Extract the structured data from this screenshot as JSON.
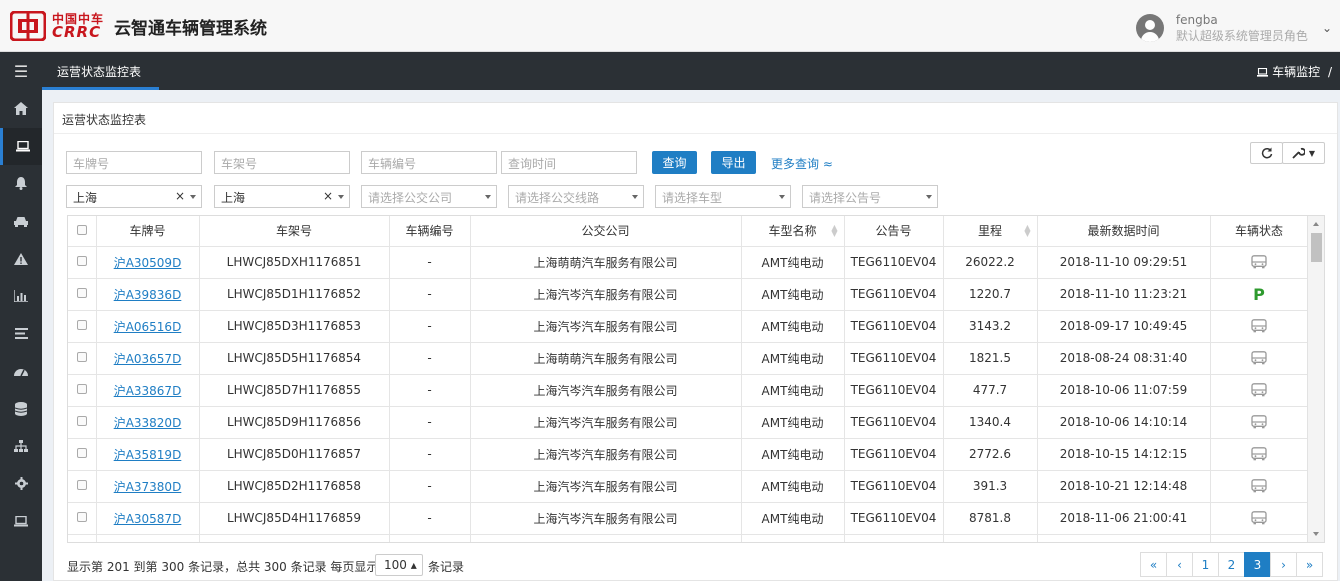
{
  "brand": {
    "cn": "中国中车",
    "en": "CRRC",
    "app_title": "云智通车辆管理系统",
    "color": "#c8161d"
  },
  "user": {
    "name": "fengba",
    "role": "默认超级系统管理员角色"
  },
  "sidebar": {
    "items": [
      "menu-icon",
      "home-icon",
      "laptop-icon",
      "bell-icon",
      "car-icon",
      "warning-icon",
      "bar-chart-icon",
      "list-icon",
      "dashboard-icon",
      "database-icon",
      "sitemap-icon",
      "gear-icon",
      "laptop-icon"
    ]
  },
  "tabs": {
    "active": "运营状态监控表"
  },
  "breadcrumb": {
    "item": "车辆监控",
    "sep": "/"
  },
  "panel": {
    "title": "运营状态监控表"
  },
  "filters": {
    "plate_ph": "车牌号",
    "frame_ph": "车架号",
    "vehicle_no_ph": "车辆编号",
    "time_ph": "查询时间",
    "query_label": "查询",
    "export_label": "导出",
    "more_label": "更多查询 ≈",
    "province": "上海",
    "city": "上海",
    "company_ph": "请选择公交公司",
    "line_ph": "请选择公交线路",
    "model_ph": "请选择车型",
    "notice_ph": "请选择公告号"
  },
  "table": {
    "headers": [
      "车牌号",
      "车架号",
      "车辆编号",
      "公交公司",
      "车型名称",
      "公告号",
      "里程",
      "最新数据时间",
      "车辆状态"
    ],
    "rows": [
      {
        "plate": "沪A30509D",
        "frame": "LHWCJ85DXH1176851",
        "vno": "-",
        "company": "上海萌萌汽车服务有限公司",
        "model": "AMT纯电动",
        "notice": "TEG6110EV04",
        "mileage": "26022.2",
        "time": "2018-11-10 09:29:51",
        "status": "bus"
      },
      {
        "plate": "沪A39836D",
        "frame": "LHWCJ85D1H1176852",
        "vno": "-",
        "company": "上海汽岑汽车服务有限公司",
        "model": "AMT纯电动",
        "notice": "TEG6110EV04",
        "mileage": "1220.7",
        "time": "2018-11-10 11:23:21",
        "status": "P"
      },
      {
        "plate": "沪A06516D",
        "frame": "LHWCJ85D3H1176853",
        "vno": "-",
        "company": "上海汽岑汽车服务有限公司",
        "model": "AMT纯电动",
        "notice": "TEG6110EV04",
        "mileage": "3143.2",
        "time": "2018-09-17 10:49:45",
        "status": "bus"
      },
      {
        "plate": "沪A03657D",
        "frame": "LHWCJ85D5H1176854",
        "vno": "-",
        "company": "上海萌萌汽车服务有限公司",
        "model": "AMT纯电动",
        "notice": "TEG6110EV04",
        "mileage": "1821.5",
        "time": "2018-08-24 08:31:40",
        "status": "bus"
      },
      {
        "plate": "沪A33867D",
        "frame": "LHWCJ85D7H1176855",
        "vno": "-",
        "company": "上海汽岑汽车服务有限公司",
        "model": "AMT纯电动",
        "notice": "TEG6110EV04",
        "mileage": "477.7",
        "time": "2018-10-06 11:07:59",
        "status": "bus"
      },
      {
        "plate": "沪A33820D",
        "frame": "LHWCJ85D9H1176856",
        "vno": "-",
        "company": "上海汽岑汽车服务有限公司",
        "model": "AMT纯电动",
        "notice": "TEG6110EV04",
        "mileage": "1340.4",
        "time": "2018-10-06 14:10:14",
        "status": "bus"
      },
      {
        "plate": "沪A35819D",
        "frame": "LHWCJ85D0H1176857",
        "vno": "-",
        "company": "上海汽岑汽车服务有限公司",
        "model": "AMT纯电动",
        "notice": "TEG6110EV04",
        "mileage": "2772.6",
        "time": "2018-10-15 14:12:15",
        "status": "bus"
      },
      {
        "plate": "沪A37380D",
        "frame": "LHWCJ85D2H1176858",
        "vno": "-",
        "company": "上海汽岑汽车服务有限公司",
        "model": "AMT纯电动",
        "notice": "TEG6110EV04",
        "mileage": "391.3",
        "time": "2018-10-21 12:14:48",
        "status": "bus"
      },
      {
        "plate": "沪A30587D",
        "frame": "LHWCJ85D4H1176859",
        "vno": "-",
        "company": "上海汽岑汽车服务有限公司",
        "model": "AMT纯电动",
        "notice": "TEG6110EV04",
        "mileage": "8781.8",
        "time": "2018-11-06 21:00:41",
        "status": "bus"
      }
    ]
  },
  "footer": {
    "summary": "显示第 201 到第 300 条记录，总共 300 条记录 每页显示",
    "page_size": "100 ▴",
    "suffix": "条记录",
    "pages": [
      "«",
      "‹",
      "1",
      "2",
      "3",
      "›",
      "»"
    ],
    "active_page": "3"
  },
  "colors": {
    "accent": "#1f7ec4",
    "sidebar": "#2b3035",
    "parked": "#2e9a2e"
  }
}
